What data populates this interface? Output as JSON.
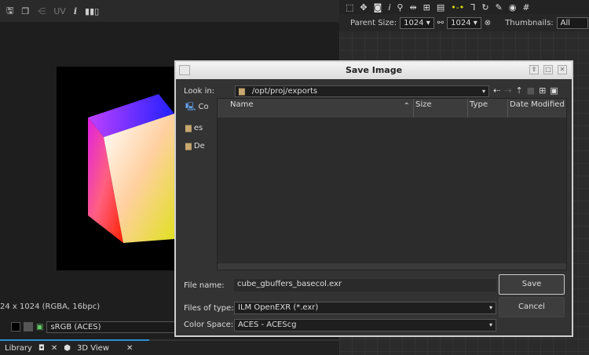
{
  "left_panel": {
    "toolbar": {
      "uv_label": "UV",
      "info_icon": "i"
    },
    "image_info": "24 x 1024 (RGBA, 16bpc)",
    "color_space": "sRGB (ACES)",
    "tabs": [
      {
        "label": "Library"
      },
      {
        "label": "3D View"
      }
    ]
  },
  "right_panel": {
    "parent_size_label": "Parent Size:",
    "parent_size_w": "1024",
    "parent_size_h": "1024",
    "thumbnails_label": "Thumbnails:",
    "thumbnails_value": "All"
  },
  "dialog": {
    "title": "Save Image",
    "look_in_label": "Look in:",
    "look_in_path": "/opt/proj/exports",
    "sidebar": [
      {
        "label": "Co"
      },
      {
        "label": "es"
      },
      {
        "label": "De"
      }
    ],
    "columns": [
      "Name",
      "Size",
      "Type",
      "Date Modified"
    ],
    "file_name_label": "File name:",
    "file_name_value": "cube_gbuffers_basecol.exr",
    "files_of_type_label": "Files of type:",
    "files_of_type_value": "ILM OpenEXR (*.exr)",
    "color_space_label": "Color Space:",
    "color_space_value": "ACES - ACEScg",
    "save_label": "Save",
    "cancel_label": "Cancel"
  }
}
